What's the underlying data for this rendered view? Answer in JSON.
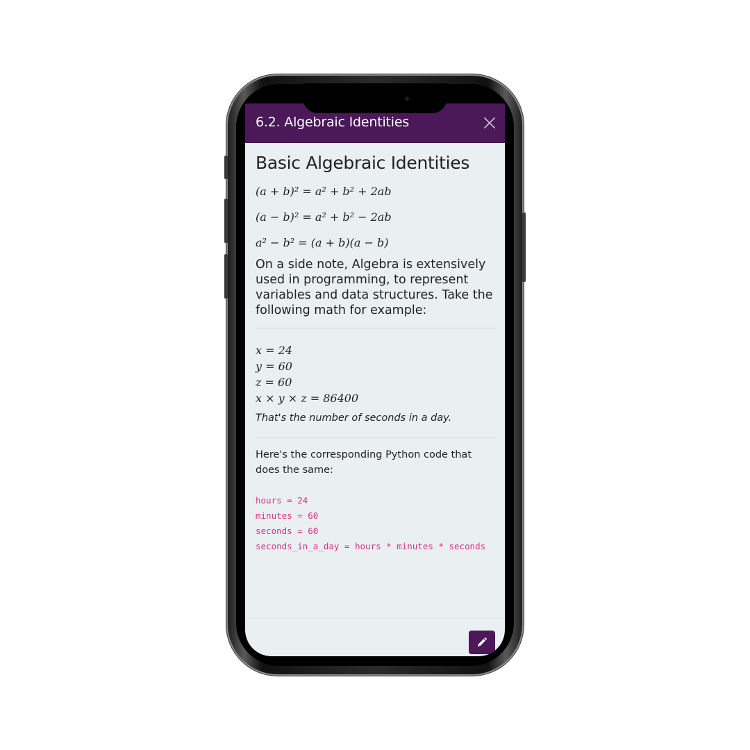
{
  "header": {
    "title": "6.2. Algebraic Identities",
    "close_icon": "close-icon"
  },
  "content": {
    "heading": "Basic Algebraic Identities",
    "identities": [
      "(a + b)² = a² + b² + 2ab",
      "(a − b)² = a² + b² − 2ab",
      "a² − b² = (a + b)(a − b)"
    ],
    "paragraph": "On a side note, Algebra is extensively used in programming, to represent variables and data structures. Take the following math for example:",
    "equations": [
      "x = 24",
      "y = 60",
      "z = 60",
      "x × y × z = 86400"
    ],
    "note": "That's the number of seconds in a day.",
    "code_intro": "Here's the corresponding Python code that does the same:",
    "code_lines": [
      "hours = 24",
      "minutes = 60",
      "seconds = 60",
      "seconds_in_a_day = hours * minutes * seconds"
    ]
  },
  "footer": {
    "edit_icon": "pencil-icon"
  },
  "colors": {
    "header_bg": "#4b1858",
    "screen_bg": "#eaeff2",
    "code_color": "#d63384"
  }
}
